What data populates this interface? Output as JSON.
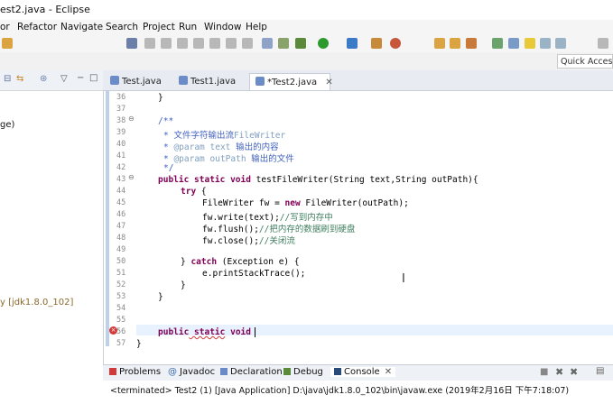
{
  "window": {
    "title": "est2.java - Eclipse"
  },
  "menu": [
    "or",
    "Refactor",
    "Navigate",
    "Search",
    "Project",
    "Run",
    "Window",
    "Help"
  ],
  "quick_access": "Quick Access",
  "left_pane": {
    "line1": "ge)",
    "line2": "y [jdk1.8.0_102]"
  },
  "editor_tabs": [
    "Test.java",
    "Test1.java",
    "*Test2.java"
  ],
  "line_numbers": [
    "36",
    "37",
    "38",
    "39",
    "40",
    "41",
    "42",
    "43",
    "44",
    "45",
    "46",
    "47",
    "48",
    "49",
    "50",
    "51",
    "52",
    "53",
    "54",
    "55",
    "56",
    "57"
  ],
  "code": {
    "l36": "}",
    "l38": "/**",
    "l39a": "* ",
    "l39b": "文件字符输出流",
    "l39c": "FileWriter",
    "l40a": "* ",
    "l40b": "@param",
    "l40c": " text ",
    "l40d": "输出的内容",
    "l41a": "* ",
    "l41b": "@param",
    "l41c": " outPath ",
    "l41d": "输出的文件",
    "l42": "*/",
    "l43a": "public static void",
    "l43b": " testFileWriter(String text,String outPath){",
    "l44a": "try",
    "l44b": " {",
    "l45a": "FileWriter fw = ",
    "l45b": "new",
    "l45c": " FileWriter(outPath);",
    "l46a": "fw.write(text);",
    "l46b": "//写到内存中",
    "l47a": "fw.flush();",
    "l47b": "//把内存的数据刷到硬盘",
    "l48a": "fw.close();",
    "l48b": "//关闭流",
    "l50a": "} ",
    "l50b": "catch",
    "l50c": " (Exception e) {",
    "l51": "e.printStackTrace();",
    "l52": "}",
    "l53": "}",
    "l56a": "public",
    "l56b": " static",
    "l56c": " void",
    "l57": "}"
  },
  "bottom_tabs": [
    "Problems",
    "Javadoc",
    "Declaration",
    "Debug",
    "Console"
  ],
  "console_text": "<terminated> Test2 (1) [Java Application] D:\\java\\jdk1.8.0_102\\bin\\javaw.exe (2019年2月16日 下午7:18:07)",
  "colors": {
    "keyword": "#7f0055",
    "comment": "#3f5fbf",
    "accent": "#bcd0ea"
  }
}
